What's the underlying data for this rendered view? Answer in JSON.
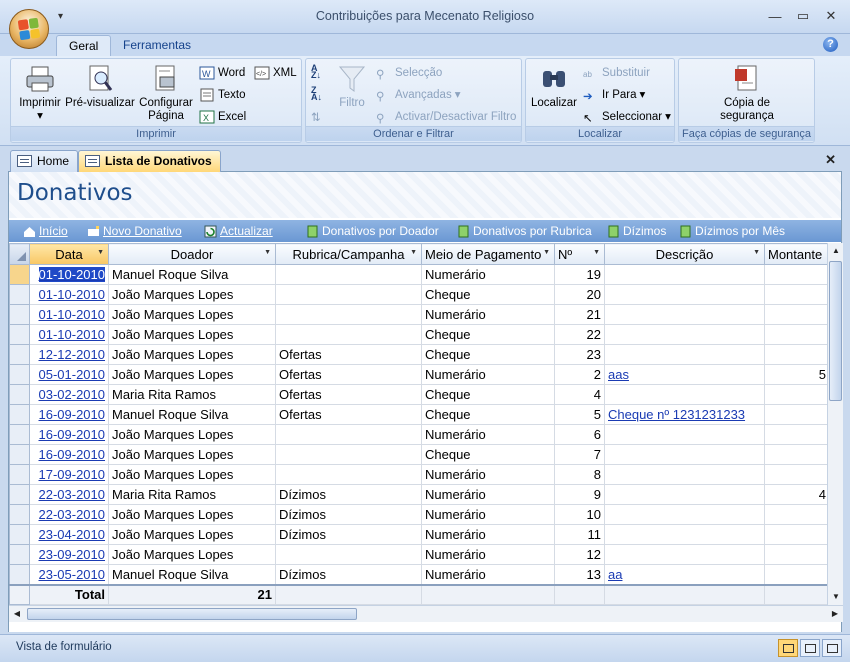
{
  "window": {
    "title": "Contribuições para Mecenato Religioso"
  },
  "ribbon_tabs": [
    "Geral",
    "Ferramentas"
  ],
  "ribbon": {
    "groups": {
      "imprimir": "Imprimir",
      "ordenar": "Ordenar e Filtrar",
      "localizar": "Localizar",
      "copias": "Faça cópias de segurança"
    },
    "imprimir": "Imprimir",
    "pre_visualizar": "Pré-visualizar",
    "configurar": "Configurar",
    "pagina": "Página",
    "word": "Word",
    "texto": "Texto",
    "excel": "Excel",
    "xml": "XML",
    "filtro": "Filtro",
    "seleccao": "Selecção",
    "avancadas": "Avançadas",
    "activar_filtro": "Activar/Desactivar Filtro",
    "localizar": "Localizar",
    "substituir": "Substituir",
    "ir_para": "Ir Para",
    "seleccionar": "Seleccionar",
    "copia": "Cópia de",
    "seguranca": "segurança"
  },
  "doc_tabs": [
    "Home",
    "Lista de Donativos"
  ],
  "form": {
    "title": "Donativos",
    "nav": {
      "inicio": "Início",
      "novo": "Novo Donativo",
      "actualizar": "Actualizar",
      "por_doador": "Donativos por Doador",
      "por_rubrica": "Donativos por Rubrica",
      "dizimos": "Dízimos",
      "dizimos_mes": "Dízimos por Mês"
    },
    "columns": [
      "Data",
      "Doador",
      "Rubrica/Campanha",
      "Meio de Pagamento",
      "Nº",
      "Descrição",
      "Montante"
    ],
    "rows": [
      [
        "01-10-2010",
        "Manuel Roque Silva",
        "",
        "Numerário",
        "19",
        "",
        ""
      ],
      [
        "01-10-2010",
        "João Marques Lopes",
        "",
        "Cheque",
        "20",
        "",
        ""
      ],
      [
        "01-10-2010",
        "João Marques Lopes",
        "",
        "Numerário",
        "21",
        "",
        ""
      ],
      [
        "01-10-2010",
        "João Marques Lopes",
        "",
        "Cheque",
        "22",
        "",
        ""
      ],
      [
        "12-12-2010",
        "João Marques Lopes",
        "Ofertas",
        "Cheque",
        "23",
        "",
        ""
      ],
      [
        "05-01-2010",
        "João Marques Lopes",
        "Ofertas",
        "Numerário",
        "2",
        "aas",
        "5"
      ],
      [
        "03-02-2010",
        "Maria Rita Ramos",
        "Ofertas",
        "Cheque",
        "4",
        "",
        ""
      ],
      [
        "16-09-2010",
        "Manuel Roque Silva",
        "Ofertas",
        "Cheque",
        "5",
        "Cheque nº 1231231233",
        ""
      ],
      [
        "16-09-2010",
        "João Marques Lopes",
        "",
        "Numerário",
        "6",
        "",
        ""
      ],
      [
        "16-09-2010",
        "João Marques Lopes",
        "",
        "Cheque",
        "7",
        "",
        ""
      ],
      [
        "17-09-2010",
        "João Marques Lopes",
        "",
        "Numerário",
        "8",
        "",
        ""
      ],
      [
        "22-03-2010",
        "Maria Rita Ramos",
        "Dízimos",
        "Numerário",
        "9",
        "",
        "4"
      ],
      [
        "22-03-2010",
        "João Marques Lopes",
        "Dízimos",
        "Numerário",
        "10",
        "",
        ""
      ],
      [
        "23-04-2010",
        "João Marques Lopes",
        "Dízimos",
        "Numerário",
        "11",
        "",
        ""
      ],
      [
        "23-09-2010",
        "João Marques Lopes",
        "",
        "Numerário",
        "12",
        "",
        ""
      ],
      [
        "23-05-2010",
        "Manuel Roque Silva",
        "Dízimos",
        "Numerário",
        "13",
        "aa",
        ""
      ]
    ],
    "total_label": "Total",
    "total_count": "21"
  },
  "status": {
    "text": "Vista de formulário"
  }
}
